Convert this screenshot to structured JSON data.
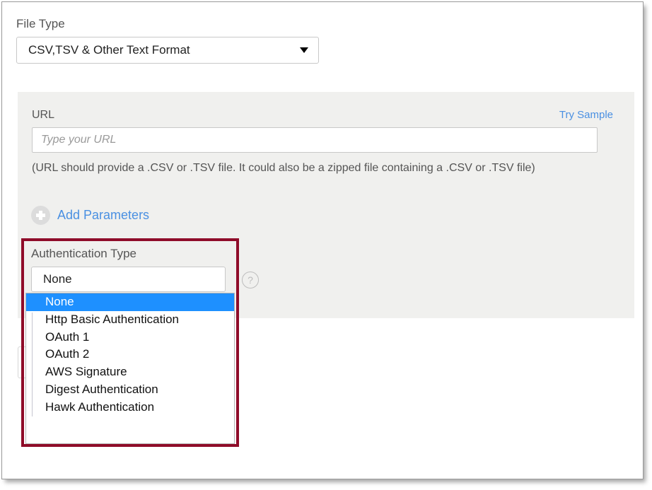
{
  "file_type": {
    "label": "File Type",
    "selected": "CSV,TSV & Other Text Format",
    "caret_icon": "chevron-down-icon"
  },
  "url_section": {
    "label": "URL",
    "try_sample_label": "Try Sample",
    "input_value": "",
    "input_placeholder": "Type your URL",
    "hint": "(URL should provide a .CSV or .TSV file. It could also be a zipped file containing a .CSV or .TSV file)",
    "add_parameters_label": "Add Parameters",
    "add_parameters_icon": "plus-circle-icon"
  },
  "authentication": {
    "label": "Authentication Type",
    "selected": "None",
    "caret_icon": "chevron-down-icon",
    "help_icon": "question-mark-icon",
    "help_glyph": "?",
    "options": [
      "None",
      "Http Basic Authentication",
      "OAuth 1",
      "OAuth 2",
      "AWS Signature",
      "Digest Authentication",
      "Hawk Authentication"
    ],
    "selected_index": 0
  },
  "colors": {
    "highlight_border": "#8f0c29",
    "link": "#4a90e2",
    "option_selected_bg": "#1e90ff",
    "panel_bg": "#f0f0ee"
  }
}
